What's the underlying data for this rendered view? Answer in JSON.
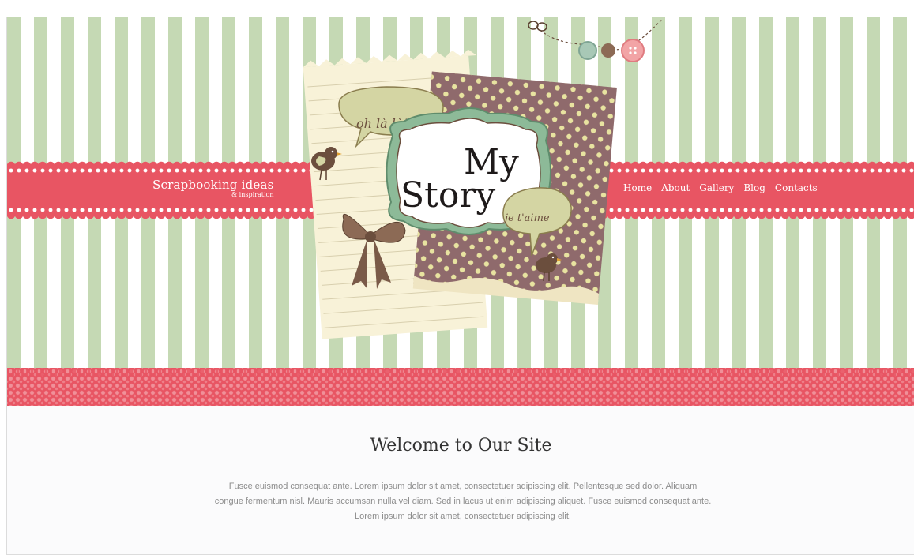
{
  "site": {
    "brand_title": "Scrapbooking ideas",
    "brand_tagline": "& inspiration"
  },
  "nav": {
    "items": [
      {
        "label": "Home"
      },
      {
        "label": "About"
      },
      {
        "label": "Gallery"
      },
      {
        "label": "Blog"
      },
      {
        "label": "Contacts"
      }
    ]
  },
  "hero": {
    "logo_line1": "My",
    "logo_line2": "Story",
    "bubble_left": "oh là là!",
    "bubble_right": "je t'aime"
  },
  "main": {
    "heading": "Welcome to Our Site",
    "paragraph": "Fusce euismod consequat ante. Lorem ipsum dolor sit amet, consectetuer adipiscing elit. Pellentesque sed dolor. Aliquam congue fermentum nisl. Mauris accumsan nulla vel diam. Sed in lacus ut enim adipiscing aliquet. Fusce euismod consequat ante. Lorem ipsum dolor sit amet, consectetuer adipiscing elit."
  },
  "colors": {
    "stripe_green": "#c5d9b4",
    "ribbon_pink": "#e85563",
    "card_brown": "#8f6a6c",
    "cream": "#f6f1d6",
    "bubble_green": "#d4d5a3"
  }
}
